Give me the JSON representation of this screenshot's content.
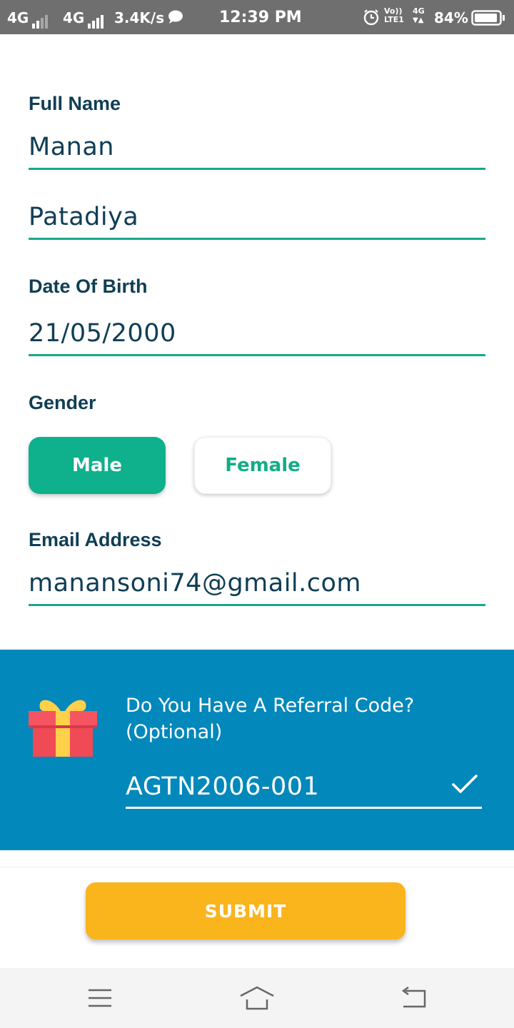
{
  "status_bar": {
    "net1": "4G",
    "net2": "4G",
    "speed": "3.4K/s",
    "time": "12:39 PM",
    "volte": "Vo))",
    "lte": "LTE1",
    "net3": "4G",
    "battery": "84%",
    "battery_level": 0.84
  },
  "form": {
    "full_name_label": "Full Name",
    "first_name": "Manan",
    "last_name": "Patadiya",
    "dob_label": "Date Of Birth",
    "dob": "21/05/2000",
    "gender_label": "Gender",
    "gender_options": [
      "Male",
      "Female"
    ],
    "gender_selected": "Male",
    "email_label": "Email Address",
    "email": "manansoni74@gmail.com"
  },
  "referral": {
    "title_line1": "Do You Have A Referral Code?",
    "title_line2": "(Optional)",
    "code": "AGTN2006-001"
  },
  "submit_label": "SUBMIT",
  "colors": {
    "accent": "#0fb08c",
    "referral_bg": "#0288bb",
    "submit": "#fab41c",
    "text": "#0f3e54"
  }
}
